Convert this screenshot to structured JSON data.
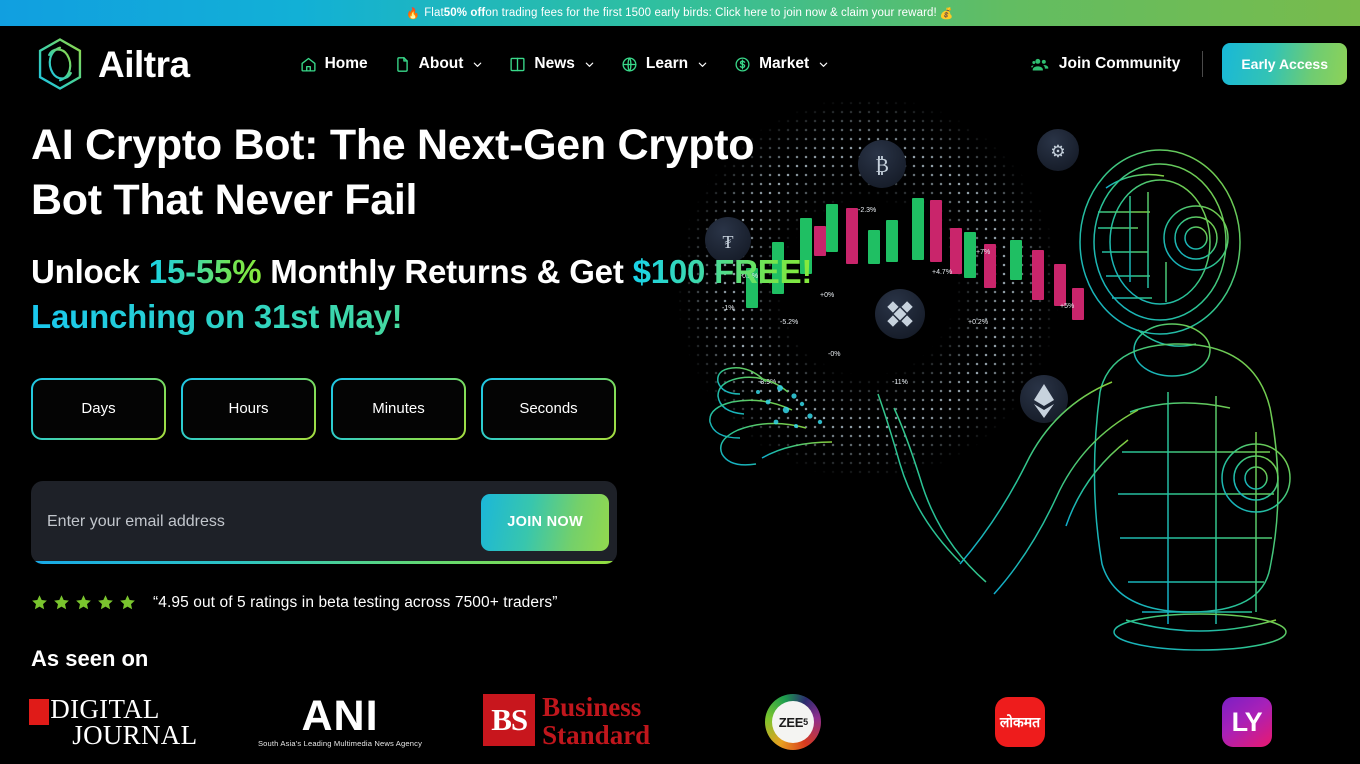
{
  "promo": {
    "fire_icon": "fire-icon",
    "prefix": "Flat ",
    "highlight": "50% off",
    "suffix": " on trading fees for the first 1500 early birds: Click here to join now & claim your reward!",
    "money_icon": "money-bag-icon"
  },
  "header": {
    "logo_icon": "ailtra-hexagon-logo-icon",
    "logo_text": "Ailtra",
    "nav": [
      {
        "label": "Home",
        "icon": "home-icon",
        "caret": false
      },
      {
        "label": "About",
        "icon": "document-icon",
        "caret": true
      },
      {
        "label": "News",
        "icon": "book-icon",
        "caret": true
      },
      {
        "label": "Learn",
        "icon": "globe-icon",
        "caret": true
      },
      {
        "label": "Market",
        "icon": "dollar-circle-icon",
        "caret": true
      }
    ],
    "join_community": {
      "label": "Join Community",
      "icon": "people-group-icon"
    },
    "early_access": "Early Access"
  },
  "hero": {
    "headline": "AI Crypto Bot: The Next-Gen Crypto Bot That Never Fail",
    "sub_prefix": "Unlock ",
    "sub_percent": "15-55%",
    "sub_middle": " Monthly Returns & Get ",
    "sub_free": "$100 FREE!",
    "sub_line2": "Launching on 31st May!",
    "countdown": [
      {
        "label": "Days",
        "value": ""
      },
      {
        "label": "Hours",
        "value": ""
      },
      {
        "label": "Minutes",
        "value": ""
      },
      {
        "label": "Seconds",
        "value": ""
      }
    ],
    "signup": {
      "placeholder": "Enter your email address",
      "value": "",
      "button": "JOIN NOW"
    },
    "ratings": {
      "star_count": 5,
      "star_icon": "star-icon",
      "text": "“4.95 out of 5 ratings in beta testing across 7500+ traders”"
    },
    "art": {
      "name": "wireframe-robot-holding-crypto-sphere",
      "coins": [
        "bitcoin-icon",
        "cardano-icon",
        "tether-icon",
        "binance-icon",
        "ethereum-icon"
      ],
      "chart_labels": [
        "-1%",
        "+0.2%",
        "-5.2%",
        "-3.8%",
        "+0%",
        "-2.3%",
        "+4.7%",
        "+7%",
        "+0.2%",
        "+5%",
        "-3.9%",
        "-11%"
      ]
    }
  },
  "as_seen": {
    "title": "As seen on",
    "logos": [
      {
        "name": "digital-journal-logo",
        "line1": "DIGITAL",
        "line2": "JOURNAL"
      },
      {
        "name": "ani-logo",
        "main": "ANI",
        "sub": "South Asia's Leading Multimedia News Agency"
      },
      {
        "name": "business-standard-logo",
        "badge": "BS",
        "line1": "Business",
        "line2": "Standard"
      },
      {
        "name": "zee5-logo",
        "main": "ZEE",
        "sup": "5"
      },
      {
        "name": "lokmat-logo",
        "main": "लोकमत"
      },
      {
        "name": "ly-logo",
        "main": "LY"
      }
    ]
  },
  "colors": {
    "accent_cyan": "#18b8d8",
    "accent_green": "#8ed257",
    "star_green": "#7ac52e",
    "background": "#000000",
    "form_bg": "#1e2128"
  }
}
